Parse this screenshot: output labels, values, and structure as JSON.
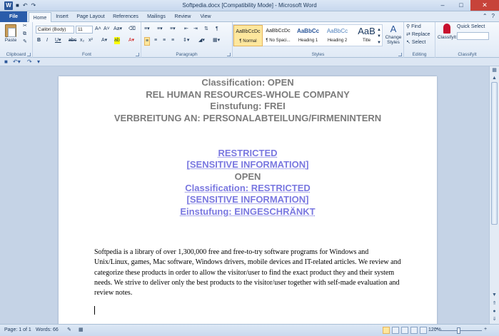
{
  "window": {
    "title": "Softpedia.docx [Compatibility Mode] - Microsoft Word"
  },
  "tabs": [
    "File",
    "Home",
    "Insert",
    "Page Layout",
    "References",
    "Mailings",
    "Review",
    "View"
  ],
  "ribbon": {
    "clipboard": {
      "label": "Clipboard",
      "paste": "Paste"
    },
    "font": {
      "label": "Font",
      "name": "Calibri (Body)",
      "size": "11"
    },
    "paragraph": {
      "label": "Paragraph"
    },
    "styles": {
      "label": "Styles",
      "items": [
        {
          "preview": "AaBbCcDc",
          "name": "¶ Normal"
        },
        {
          "preview": "AaBbCcDc",
          "name": "¶ No Spaci..."
        },
        {
          "preview": "AaBbCc",
          "name": "Heading 1"
        },
        {
          "preview": "AaBbCc",
          "name": "Heading 2"
        },
        {
          "preview": "AaB",
          "name": "Title"
        }
      ],
      "change_styles": "Change Styles"
    },
    "editing": {
      "label": "Editing",
      "find": "Find",
      "replace": "Replace",
      "select": "Select"
    },
    "classifyit": {
      "label": "ClassifyIt",
      "button": "ClassifyIt",
      "quick_select": "Quick Select"
    }
  },
  "document": {
    "header_lines": [
      "Classification: OPEN",
      "REL HUMAN RESOURCES-WHOLE COMPANY",
      "Einstufung: FREI",
      "VERBREITUNG AN: PERSONALABTEILUNG/FIRMENINTERN"
    ],
    "restricted_lines": [
      "RESTRICTED",
      "[SENSITIVE INFORMATION]",
      "OPEN",
      "Classification: RESTRICTED",
      "[SENSITIVE INFORMATION]",
      "Einstufung: EINGESCHRÄNKT"
    ],
    "body": "Softpedia is a library of over 1,300,000 free and free-to-try software programs for Windows and Unix/Linux, games, Mac software, Windows drivers, mobile devices and IT-related articles. We review and categorize these products in order to allow the visitor/user to find the exact product they and their system needs. We strive to deliver only the best products to the visitor/user together with self-made evaluation and review notes."
  },
  "status": {
    "page": "Page: 1 of 1",
    "words": "Words: 66",
    "zoom": "120%"
  },
  "colors": {
    "accent": "#2a5caa",
    "classification_blue": "#7a78e0",
    "header_gray": "#7b7b7b"
  }
}
